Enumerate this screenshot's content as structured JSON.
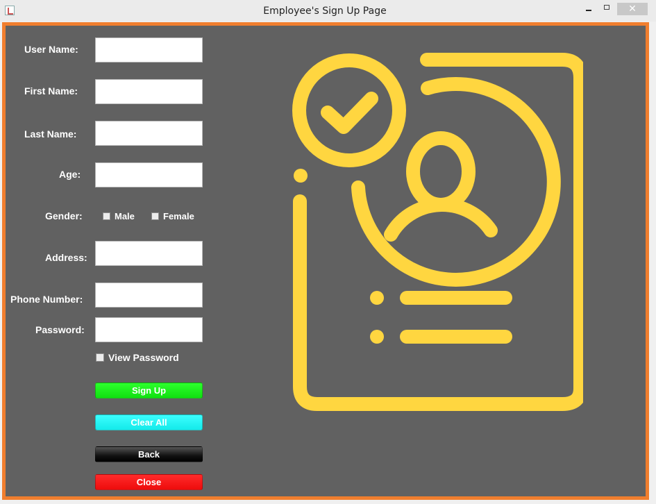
{
  "window": {
    "title": "Employee's Sign Up Page",
    "close_glyph": "✕"
  },
  "form": {
    "username_label": "User Name:",
    "firstname_label": "First Name:",
    "lastname_label": "Last Name:",
    "age_label": "Age:",
    "gender_label": "Gender:",
    "gender_male": "Male",
    "gender_female": "Female",
    "address_label": "Address:",
    "phone_label": "Phone Number:",
    "password_label": "Password:",
    "view_password": "View Password"
  },
  "buttons": {
    "signup": "Sign Up",
    "clear": "Clear All",
    "back": "Back",
    "close": "Close"
  },
  "colors": {
    "frame_border": "#f07e2e",
    "panel_bg": "#616161",
    "illustration": "#ffd640"
  },
  "icons": [
    "java-app-icon",
    "minimize-icon",
    "maximize-icon",
    "close-icon",
    "user-profile-illustration"
  ]
}
